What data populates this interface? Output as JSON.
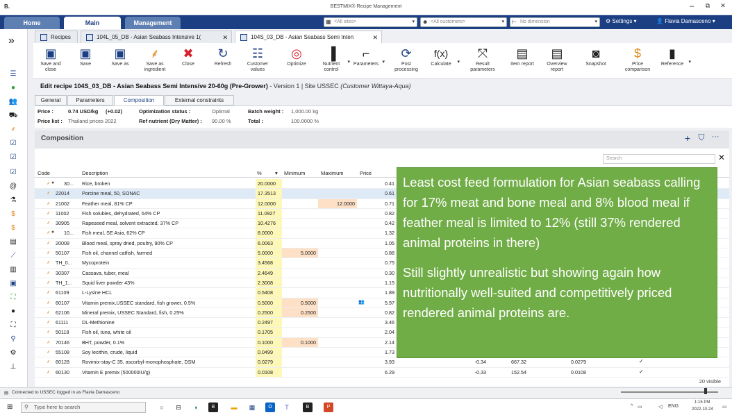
{
  "window": {
    "app_icon": "B.",
    "title": "BESTMIX® Recipe Management",
    "minimize": "–",
    "restore": "⧉",
    "close": "✕"
  },
  "nav": {
    "tabs": [
      {
        "label": "Home"
      },
      {
        "label": "Main"
      },
      {
        "label": "Management"
      }
    ],
    "sites_placeholder": "<All sites>",
    "customers_placeholder": "<All customers>",
    "dimension_placeholder": "No dimension",
    "settings_label": "Settings",
    "user_label": "Flavia Damasceno"
  },
  "doc_tabs": [
    {
      "label": "Recipes"
    },
    {
      "label": "104L_05_DB - Asian Seabass Intensive 1("
    },
    {
      "label": "104S_03_DB - Asian Seabass Semi Inten"
    }
  ],
  "toolbar": [
    {
      "label": "Save and close",
      "icon": "save-close-icon"
    },
    {
      "label": "Save",
      "icon": "save-icon"
    },
    {
      "label": "Save as",
      "icon": "save-as-icon"
    },
    {
      "label": "Save as ingredient",
      "icon": "save-as-ingredient-icon"
    },
    {
      "label": "Close",
      "icon": "close-icon"
    },
    {
      "label": "Refresh",
      "icon": "refresh-icon"
    },
    {
      "label": "Customer values",
      "icon": "customer-values-icon"
    },
    {
      "label": "Optimize",
      "icon": "target-icon"
    },
    {
      "label": "Nutrient control",
      "icon": "bar-chart-icon"
    },
    {
      "label": "Parameters",
      "icon": "steps-icon"
    },
    {
      "label": "Post processing",
      "icon": "cycle-icon"
    },
    {
      "label": "Calculate",
      "icon": "function-icon"
    },
    {
      "label": "Result parameters",
      "icon": "result-icon"
    },
    {
      "label": "Item report",
      "icon": "report-icon"
    },
    {
      "label": "Overview report",
      "icon": "overview-report-icon"
    },
    {
      "label": "Snapshot",
      "icon": "camera-icon"
    },
    {
      "label": "Price comparison",
      "icon": "price-icon"
    },
    {
      "label": "Reference",
      "icon": "bookmark-icon"
    }
  ],
  "recipe": {
    "prefix": "Edit recipe ",
    "name": "104S_03_DB - Asian Seabass Semi Intensive  20-60g (Pre-Grower)",
    "version": " - Version 1 | Site USSEC ",
    "customer": "(Customer Wittaya-Aqua)"
  },
  "sub_tabs": [
    {
      "label": "General"
    },
    {
      "label": "Parameters"
    },
    {
      "label": "Composition"
    },
    {
      "label": "External constraints"
    }
  ],
  "info": {
    "price_label": "Price :",
    "price_value": "0.74 USD/kg",
    "price_change": "(+0.02)",
    "price_list_label": "Price list :",
    "price_list_value": "Thailand prices 2022",
    "opt_status_label": "Optimization status :",
    "opt_status_value": "Optimal",
    "ref_nutrient_label": "Ref nutrient (Dry Matter) :",
    "ref_nutrient_value": "90.00 %",
    "batch_label": "Batch weight :",
    "batch_value": "1,000.00 kg",
    "total_label": "Total :",
    "total_value": "100.0000 %"
  },
  "composition": {
    "title": "Composition",
    "search_placeholder": "Search",
    "visible_count": "20 visible",
    "columns": {
      "code": "Code",
      "description": "Description",
      "pct": "%",
      "min": "Minimum",
      "max": "Maximum",
      "price": "Price"
    },
    "rows": [
      {
        "code": "30...",
        "desc": "Rice, broken",
        "pct": "20.0000",
        "min": "",
        "max": "",
        "price": "0.41",
        "x1": "",
        "x2": "",
        "x3": "",
        "x4": ""
      },
      {
        "code": "22014",
        "desc": "Porcine meal, 50, SONAC",
        "pct": "17.3513",
        "min": "",
        "max": "",
        "price": "0.61",
        "x1": "",
        "x2": "",
        "x3": "",
        "x4": ""
      },
      {
        "code": "21002",
        "desc": "Feather meal, 81% CP",
        "pct": "12.0000",
        "min": "",
        "max": "12.0000",
        "price": "0.71",
        "x1": "",
        "x2": "",
        "x3": "",
        "x4": ""
      },
      {
        "code": "11002",
        "desc": "Fish solubles, dehydrated, 64% CP",
        "pct": "11.0927",
        "min": "",
        "max": "",
        "price": "0.82",
        "x1": "",
        "x2": "",
        "x3": "",
        "x4": ""
      },
      {
        "code": "30905",
        "desc": "Rapeseed meal, solvent extracted, 37% CP",
        "pct": "10.4276",
        "min": "",
        "max": "",
        "price": "0.42",
        "x1": "",
        "x2": "",
        "x3": "",
        "x4": ""
      },
      {
        "code": "10...",
        "desc": "Fish meal, SE Asia, 62% CP",
        "pct": "8.0000",
        "min": "",
        "max": "",
        "price": "1.32",
        "x1": "",
        "x2": "",
        "x3": "",
        "x4": ""
      },
      {
        "code": "20008",
        "desc": "Blood meal, spray dried, poultry, 90% CP",
        "pct": "6.0063",
        "min": "",
        "max": "",
        "price": "1.05",
        "x1": "",
        "x2": "",
        "x3": "",
        "x4": ""
      },
      {
        "code": "50107",
        "desc": "Fish oil, channel catfish, farmed",
        "pct": "5.0000",
        "min": "5.0000",
        "max": "",
        "price": "0.88",
        "x1": "",
        "x2": "",
        "x3": "",
        "x4": ""
      },
      {
        "code": "TH_0...",
        "desc": "Mycoprotein",
        "pct": "3.4568",
        "min": "",
        "max": "",
        "price": "0.75",
        "x1": "",
        "x2": "",
        "x3": "",
        "x4": ""
      },
      {
        "code": "30307",
        "desc": "Cassava, tuber, meal",
        "pct": "2.4649",
        "min": "",
        "max": "",
        "price": "0.30",
        "x1": "",
        "x2": "",
        "x3": "",
        "x4": ""
      },
      {
        "code": "TH_1...",
        "desc": "Squid liver powder 43%",
        "pct": "2.3008",
        "min": "",
        "max": "",
        "price": "1.15",
        "x1": "",
        "x2": "",
        "x3": "",
        "x4": ""
      },
      {
        "code": "61109",
        "desc": "L-Lysine HCL",
        "pct": "0.5408",
        "min": "",
        "max": "",
        "price": "1.89",
        "x1": "",
        "x2": "",
        "x3": "",
        "x4": ""
      },
      {
        "code": "60107",
        "desc": "Vitamin premix,USSEC standard, fish grower, 0.5%",
        "pct": "0.5000",
        "min": "0.5000",
        "max": "",
        "price": "5.97",
        "x1": "",
        "x2": "",
        "x3": "",
        "x4": ""
      },
      {
        "code": "62106",
        "desc": "Mineral premix, USSEC Standard, fish, 0.25%",
        "pct": "0.2500",
        "min": "0.2500",
        "max": "",
        "price": "0.82",
        "x1": "",
        "x2": "",
        "x3": "",
        "x4": ""
      },
      {
        "code": "61111",
        "desc": "DL-Methionine",
        "pct": "0.2497",
        "min": "",
        "max": "",
        "price": "3.46",
        "x1": "",
        "x2": "",
        "x3": "",
        "x4": ""
      },
      {
        "code": "50118",
        "desc": "Fish oil, tuna, white oil",
        "pct": "0.1705",
        "min": "",
        "max": "",
        "price": "2.04",
        "x1": "",
        "x2": "",
        "x3": "",
        "x4": ""
      },
      {
        "code": "70146",
        "desc": "BHT, powder, 0.1%",
        "pct": "0.1000",
        "min": "0.1000",
        "max": "",
        "price": "2.14",
        "x1": "",
        "x2": "",
        "x3": "",
        "x4": ""
      },
      {
        "code": "55108",
        "desc": "Soy lecithin, crude, liquid",
        "pct": "0.0499",
        "min": "",
        "max": "",
        "price": "1.73",
        "x1": "",
        "x2": "",
        "x3": "",
        "x4": ""
      },
      {
        "code": "60128",
        "desc": "Rovimix-stay-C 35, ascorbyl-monophosphate, DSM",
        "pct": "0.0279",
        "min": "",
        "max": "",
        "price": "3.93",
        "x1": "-0.34",
        "x2": "667.32",
        "x3": "0.0279",
        "x4": "✓"
      },
      {
        "code": "60130",
        "desc": "Vitamin E premix (500000IU/g)",
        "pct": "0.0108",
        "min": "",
        "max": "",
        "price": "6.29",
        "x1": "-0.33",
        "x2": "152.54",
        "x3": "0.0108",
        "x4": "✓"
      }
    ]
  },
  "overlay": {
    "p1": "Least cost feed formulation for Asian seabass calling for 17% meat and bone meal and 8% blood meal if feather meal is limited to 12% (still 37% rendered animal proteins in there)",
    "p2": "Still slightly unrealistic but showing again how nutritionally well-suited and competitively priced rendered animal proteins are."
  },
  "status": {
    "text": "Connected to USSEC logged in as Flavia Damasceno"
  },
  "taskbar": {
    "search_placeholder": "Type here to search",
    "tray_lang": "ENG",
    "time": "1:15 PM",
    "date": "2022-10-24"
  }
}
